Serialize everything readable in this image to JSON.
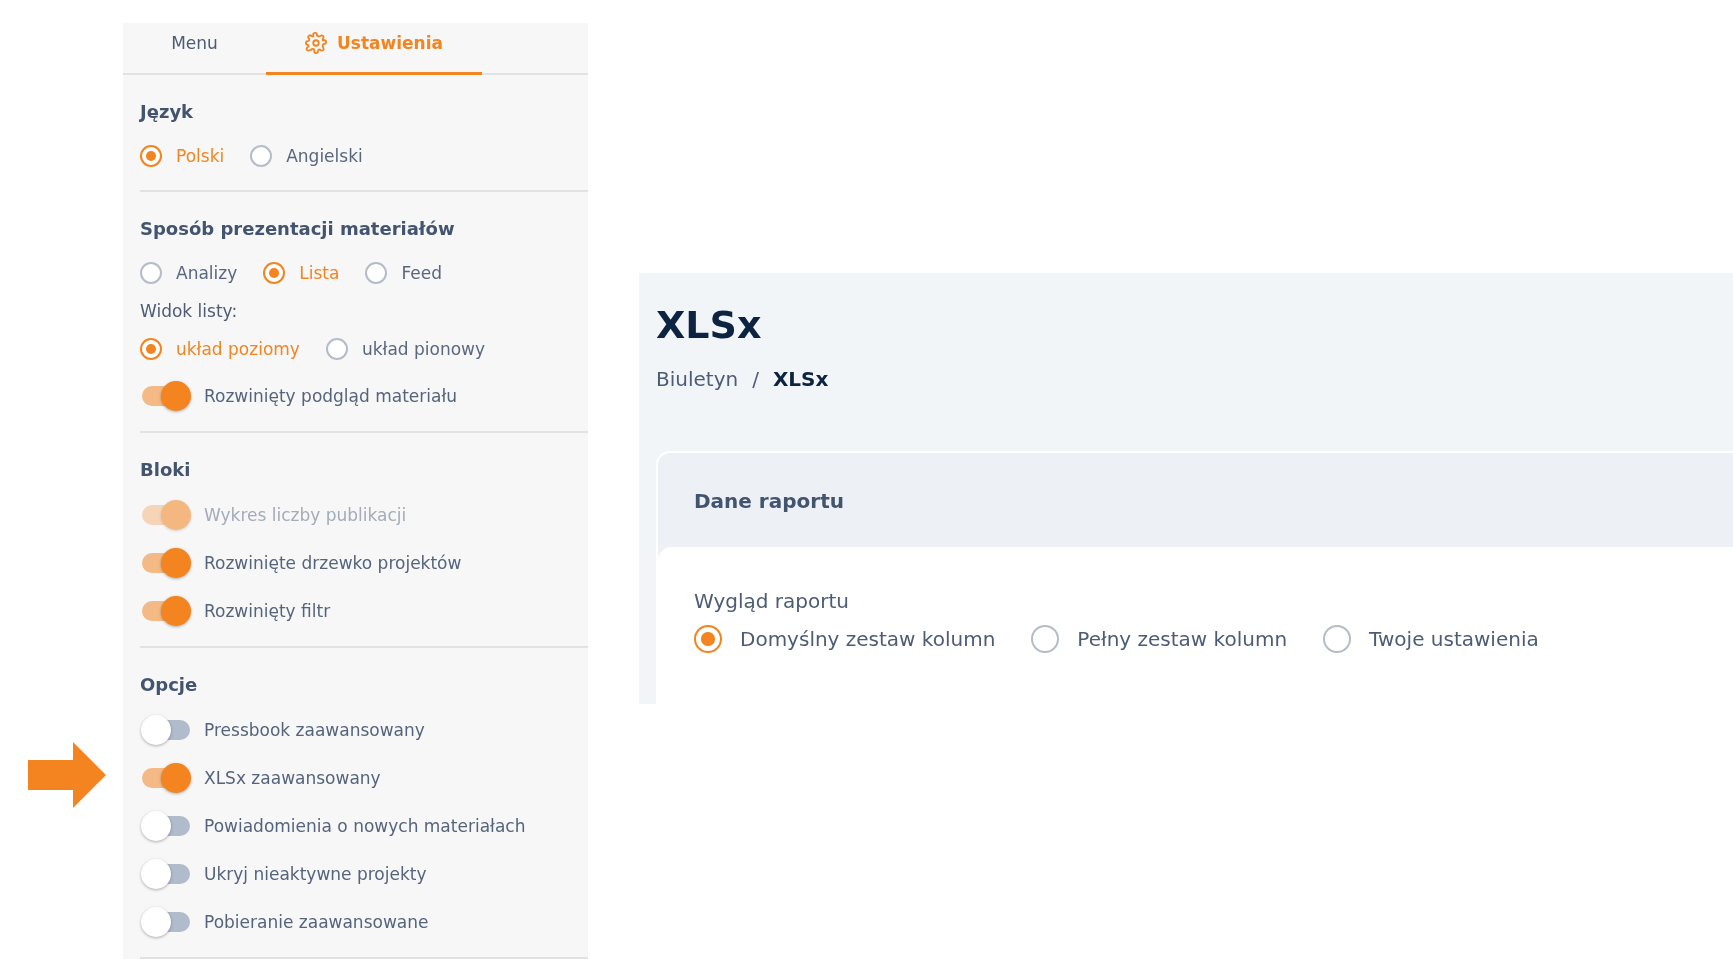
{
  "tabs": [
    {
      "label": "Menu",
      "kind": "plain",
      "selected": false
    },
    {
      "label": "Ustawienia",
      "kind": "settings",
      "selected": true
    }
  ],
  "sections": [
    {
      "title": "Język",
      "items": [
        {
          "kind": "radio-group",
          "options": [
            {
              "label": "Polski",
              "selected": true
            },
            {
              "label": "Angielski",
              "selected": false
            }
          ]
        }
      ]
    },
    {
      "title": "Sposób prezentacji materiałów",
      "items": [
        {
          "kind": "radio-group",
          "options": [
            {
              "label": "Analizy",
              "selected": false
            },
            {
              "label": "Lista",
              "selected": true
            },
            {
              "label": "Feed",
              "selected": false
            }
          ]
        },
        {
          "kind": "label",
          "text": "Widok listy:"
        },
        {
          "kind": "radio-group",
          "options": [
            {
              "label": "układ poziomy",
              "selected": true
            },
            {
              "label": "układ pionowy",
              "selected": false
            }
          ]
        },
        {
          "kind": "toggle",
          "label": "Rozwinięty podgląd materiału",
          "on": true,
          "disabled": false
        }
      ]
    },
    {
      "title": "Bloki",
      "items": [
        {
          "kind": "toggle",
          "label": "Wykres liczby publikacji",
          "on": true,
          "disabled": true
        },
        {
          "kind": "toggle",
          "label": "Rozwinięte drzewko projektów",
          "on": true,
          "disabled": false
        },
        {
          "kind": "toggle",
          "label": "Rozwinięty filtr",
          "on": true,
          "disabled": false
        }
      ]
    },
    {
      "title": "Opcje",
      "items": [
        {
          "kind": "toggle",
          "label": "Pressbook zaawansowany",
          "on": false,
          "disabled": false,
          "pointed": false
        },
        {
          "kind": "toggle",
          "label": "XLSx zaawansowany",
          "on": true,
          "disabled": false,
          "pointed": true
        },
        {
          "kind": "toggle",
          "label": "Powiadomienia o nowych materiałach",
          "on": false,
          "disabled": false,
          "pointed": false
        },
        {
          "kind": "toggle",
          "label": "Ukryj nieaktywne projekty",
          "on": false,
          "disabled": false,
          "pointed": false
        },
        {
          "kind": "toggle",
          "label": "Pobieranie zaawansowane",
          "on": false,
          "disabled": false,
          "pointed": false
        }
      ]
    }
  ],
  "main": {
    "title": "XLSx",
    "breadcrumb": [
      {
        "label": "Biuletyn",
        "current": false
      },
      {
        "label": "XLSx",
        "current": true
      }
    ],
    "breadcrumb_separator": "/",
    "card": {
      "title": "Dane raportu",
      "field_label": "Wygląd raportu",
      "options": [
        {
          "label": "Domyślny zestaw kolumn",
          "selected": true
        },
        {
          "label": "Pełny zestaw kolumn",
          "selected": false
        },
        {
          "label": "Twoje ustawienia",
          "selected": false
        }
      ]
    }
  }
}
